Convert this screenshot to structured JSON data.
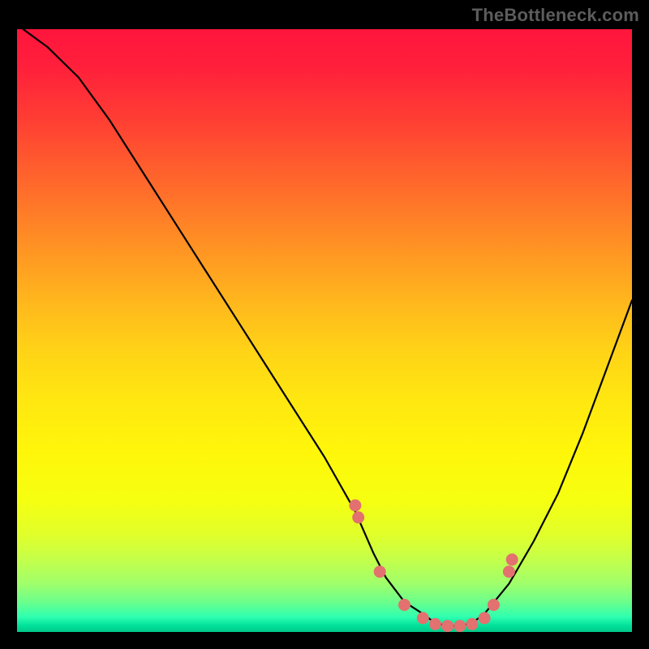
{
  "watermark": "TheBottleneck.com",
  "chart_data": {
    "type": "line",
    "title": "",
    "xlabel": "",
    "ylabel": "",
    "xlim": [
      0,
      100
    ],
    "ylim": [
      0,
      100
    ],
    "grid": false,
    "series": [
      {
        "name": "curve",
        "x": [
          1,
          5,
          10,
          15,
          20,
          25,
          30,
          35,
          40,
          45,
          50,
          55,
          58,
          60,
          63,
          66,
          68,
          70,
          72,
          74,
          76,
          80,
          84,
          88,
          92,
          96,
          100
        ],
        "y": [
          100,
          97,
          92,
          85,
          77,
          69,
          61,
          53,
          45,
          37,
          29,
          20,
          13,
          9,
          5,
          3,
          1.5,
          1,
          1,
          1.5,
          3,
          8,
          15,
          23,
          33,
          44,
          55
        ]
      }
    ],
    "highlight_points": {
      "name": "markers",
      "x": [
        55,
        55.5,
        59,
        63,
        66,
        68,
        70,
        72,
        74,
        76,
        77.5,
        80,
        80.5
      ],
      "y": [
        21,
        19,
        10,
        4.5,
        2.3,
        1.3,
        1,
        1,
        1.3,
        2.3,
        4.5,
        10,
        12
      ]
    },
    "colors": {
      "curve": "#000000",
      "markers": "#e2716f",
      "gradient_top": "#ff153c",
      "gradient_bottom": "#00c988"
    }
  }
}
